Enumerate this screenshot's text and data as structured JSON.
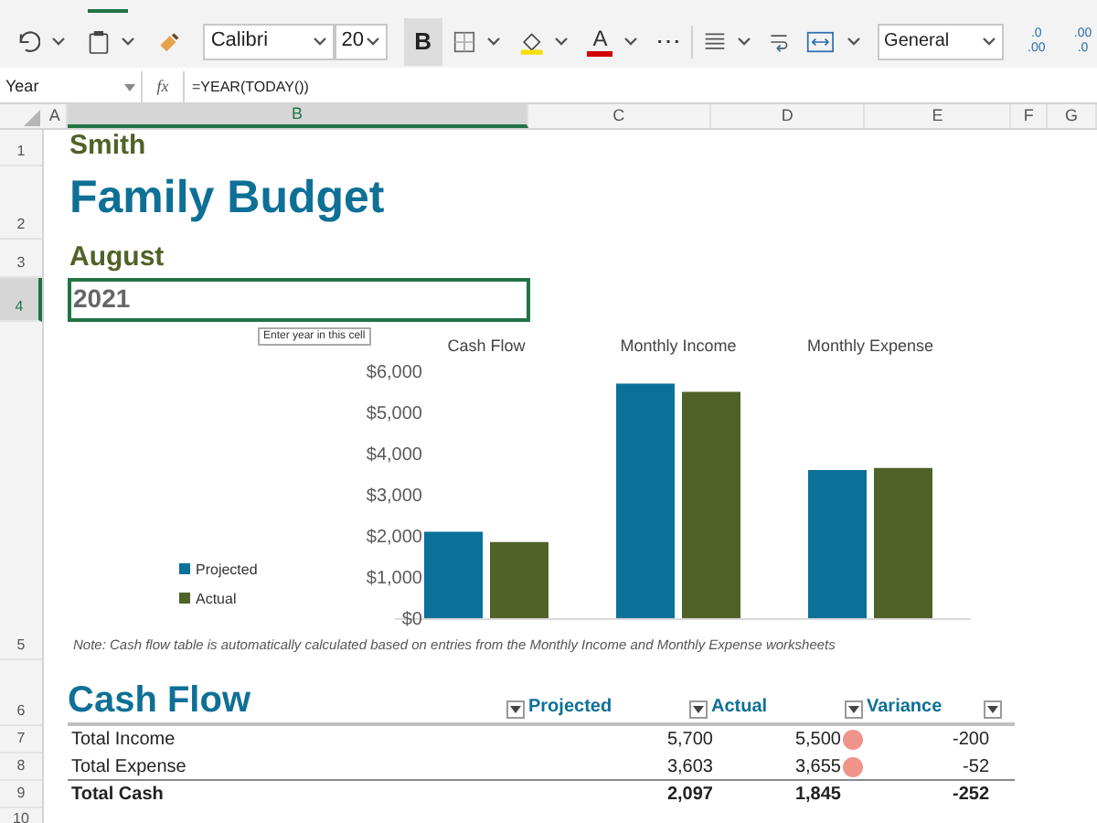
{
  "ribbon": {
    "font_name": "Calibri",
    "font_size": "20",
    "bold": {
      "label": "B",
      "pressed": true
    },
    "font_color_label": "A",
    "more": "⋯",
    "number_format": "General",
    "increase_decimal": [
      ".0",
      ".00"
    ],
    "decrease_decimal": [
      ".00",
      ".0"
    ]
  },
  "formula_bar": {
    "name_box": "Year",
    "fx": "fx",
    "formula": "=YEAR(TODAY())"
  },
  "columns": [
    {
      "label": "A",
      "selected": false
    },
    {
      "label": "B",
      "selected": true
    },
    {
      "label": "C",
      "selected": false
    },
    {
      "label": "D",
      "selected": false
    },
    {
      "label": "E",
      "selected": false
    },
    {
      "label": "F",
      "selected": false
    },
    {
      "label": "G",
      "selected": false
    }
  ],
  "rows": [
    {
      "label": "1",
      "selected": false
    },
    {
      "label": "2",
      "selected": false
    },
    {
      "label": "3",
      "selected": false
    },
    {
      "label": "4",
      "selected": true
    },
    {
      "label": "5",
      "selected": false
    },
    {
      "label": "6",
      "selected": false
    },
    {
      "label": "7",
      "selected": false
    },
    {
      "label": "8",
      "selected": false
    },
    {
      "label": "9",
      "selected": false
    },
    {
      "label": "10",
      "selected": false
    }
  ],
  "sheet": {
    "name": "Smith",
    "title": "Family Budget",
    "month": "August",
    "year": "2021",
    "tooltip": "Enter year in this cell",
    "chart": {
      "chart_data": {
        "type": "bar",
        "categories": [
          "Cash Flow",
          "Monthly Income",
          "Monthly Expense"
        ],
        "series": [
          {
            "name": "Projected",
            "color": "#0a719a",
            "values": [
              2100,
              5700,
              3600
            ]
          },
          {
            "name": "Actual",
            "color": "#4f6228",
            "values": [
              1850,
              5500,
              3650
            ]
          }
        ],
        "ylim": [
          0,
          6000
        ],
        "legend": true,
        "yticks": [
          {
            "value": 0,
            "label": "$0"
          },
          {
            "value": 1000,
            "label": "$1,000"
          },
          {
            "value": 2000,
            "label": "$2,000"
          },
          {
            "value": 3000,
            "label": "$3,000"
          },
          {
            "value": 4000,
            "label": "$4,000"
          },
          {
            "value": 5000,
            "label": "$5,000"
          },
          {
            "value": 6000,
            "label": "$6,000"
          }
        ]
      }
    },
    "note": "Note: Cash flow table is automatically calculated based on entries from the Monthly Income and Monthly Expense worksheets",
    "cash_flow": {
      "title": "Cash Flow",
      "columns": [
        "Projected",
        "Actual",
        "Variance"
      ],
      "rows": [
        {
          "kind": "item",
          "label": "Total Income",
          "projected": "5,700",
          "actual": "5,500",
          "variance": "-200",
          "flag": true
        },
        {
          "kind": "item",
          "label": "Total Expense",
          "projected": "3,603",
          "actual": "3,655",
          "variance": "-52",
          "flag": true
        },
        {
          "kind": "total",
          "label": "Total Cash",
          "projected": "2,097",
          "actual": "1,845",
          "variance": "-252",
          "flag": false
        }
      ]
    }
  }
}
